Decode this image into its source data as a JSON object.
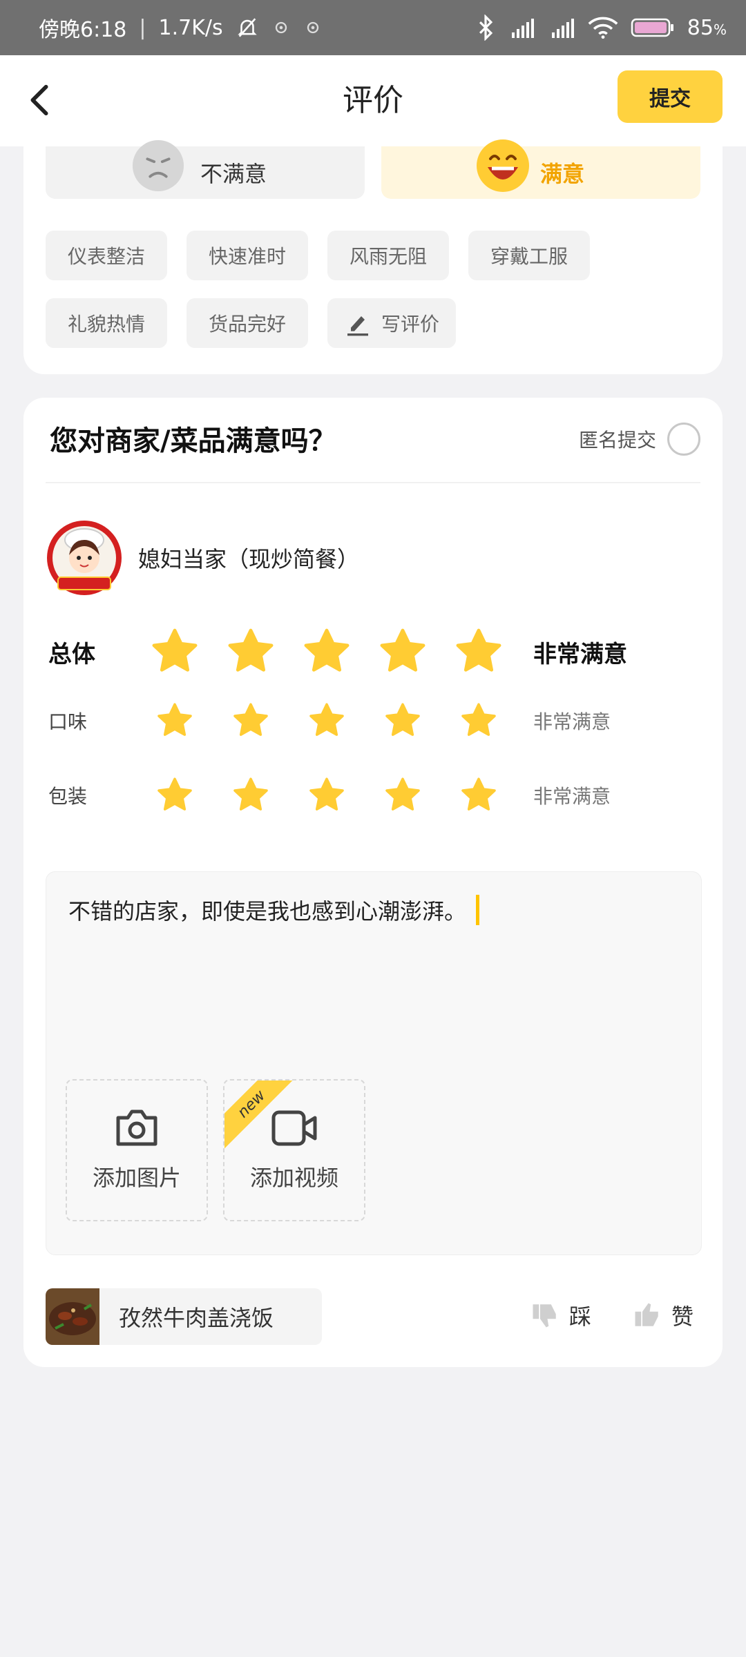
{
  "status_bar": {
    "time": "傍晚6:18",
    "speed": "1.7K/s",
    "battery": "85",
    "battery_unit": "%",
    "icons": [
      "mute-bell-icon",
      "app-notification-icon",
      "app-notification-icon",
      "bluetooth-icon",
      "signal-hd-icon",
      "signal-hd-icon",
      "wifi-icon",
      "battery-icon"
    ]
  },
  "header": {
    "title": "评价",
    "submit_label": "提交"
  },
  "rider_review": {
    "moods": {
      "bad": "不满意",
      "good": "满意",
      "selected": "good"
    },
    "tags": [
      "仪表整洁",
      "快速准时",
      "风雨无阻",
      "穿戴工服",
      "礼貌热情",
      "货品完好"
    ],
    "write_review": "写评价"
  },
  "merchant_review": {
    "question": "您对商家/菜品满意吗？",
    "anonymous_label": "匿名提交",
    "anonymous_checked": false,
    "shop_name": "媳妇当家（现炒简餐）",
    "ratings": [
      {
        "label": "总体",
        "stars": 5,
        "max": 5,
        "text": "非常满意"
      },
      {
        "label": "口味",
        "stars": 5,
        "max": 5,
        "text": "非常满意"
      },
      {
        "label": "包装",
        "stars": 5,
        "max": 5,
        "text": "非常满意"
      }
    ],
    "comment": "不错的店家，即使是我也感到心潮澎湃。",
    "add_photo": "添加图片",
    "add_video": "添加视频",
    "new_badge": "new",
    "dish_name": "孜然牛肉盖浇饭",
    "dislike_label": "踩",
    "like_label": "赞"
  },
  "colors": {
    "accent_yellow": "#ffd23f",
    "star_yellow": "#ffcc33",
    "good_text": "#f2a400",
    "status_bar": "#707070"
  }
}
